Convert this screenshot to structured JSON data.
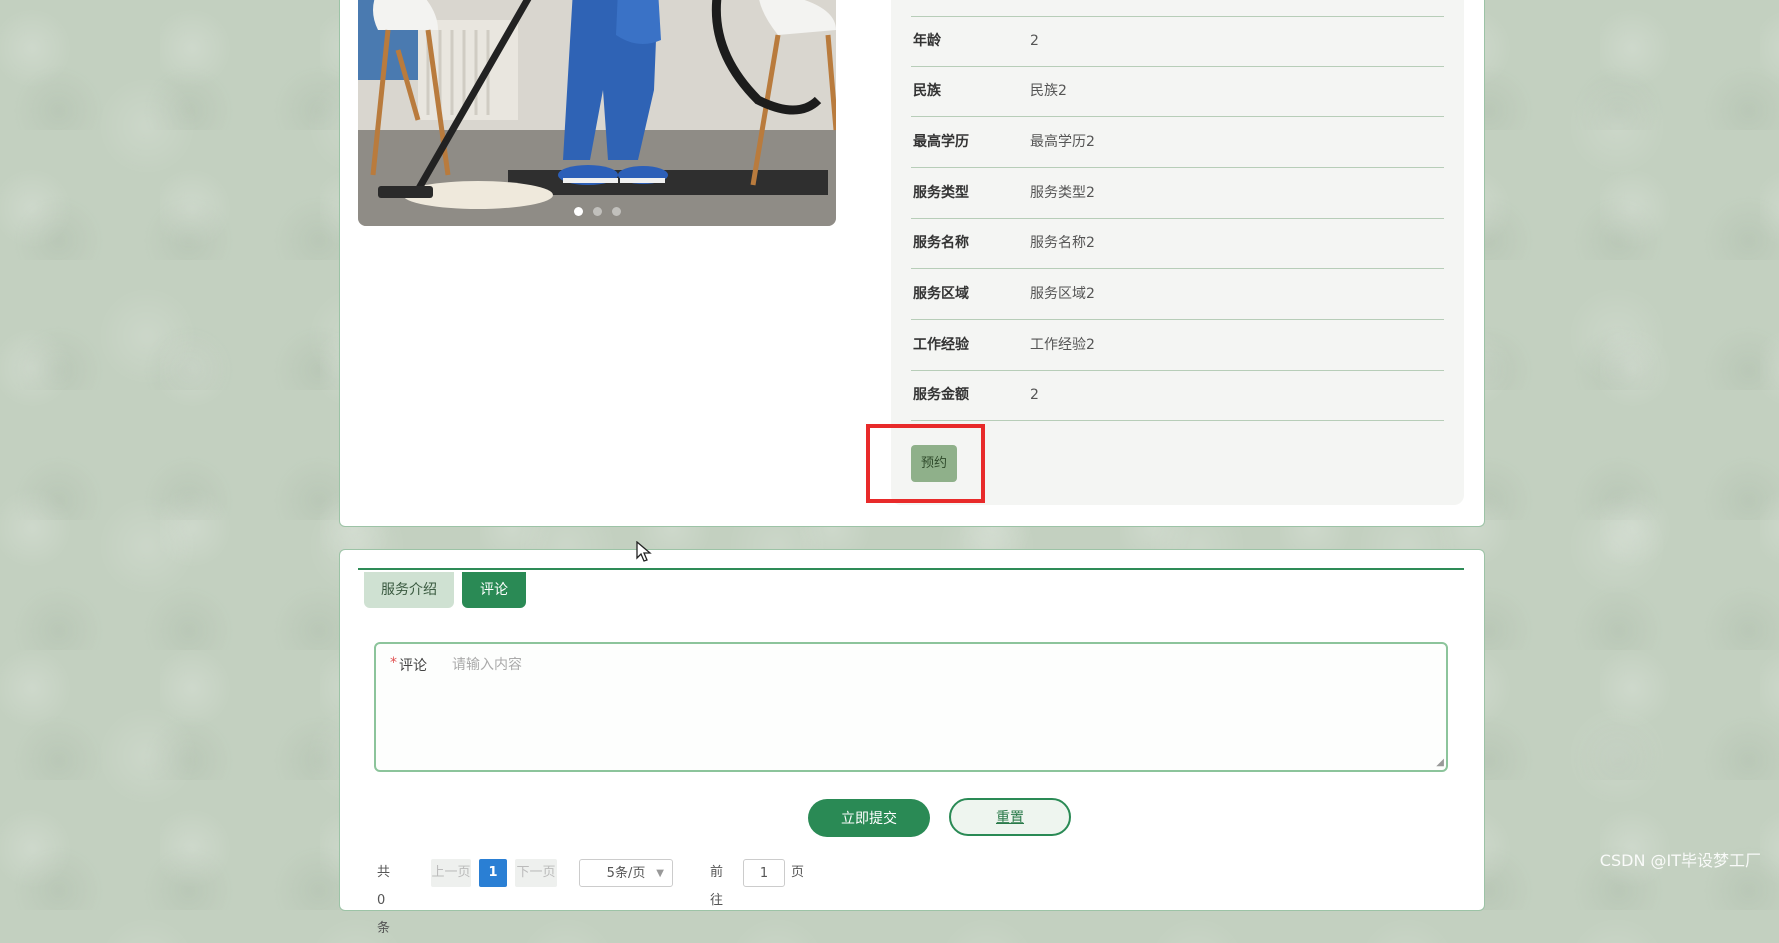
{
  "details": {
    "rows": [
      {
        "label": "年龄",
        "value": "2"
      },
      {
        "label": "民族",
        "value": "民族2"
      },
      {
        "label": "最高学历",
        "value": "最高学历2"
      },
      {
        "label": "服务类型",
        "value": "服务类型2"
      },
      {
        "label": "服务名称",
        "value": "服务名称2"
      },
      {
        "label": "服务区域",
        "value": "服务区域2"
      },
      {
        "label": "工作经验",
        "value": "工作经验2"
      },
      {
        "label": "服务金额",
        "value": "2"
      }
    ],
    "reserve_label": "预约"
  },
  "carousel": {
    "slide_count": 3,
    "active_index": 0
  },
  "tabs": [
    {
      "label": "服务介绍",
      "active": false
    },
    {
      "label": "评论",
      "active": true
    }
  ],
  "comment_form": {
    "label": "评论",
    "required_mark": "*",
    "placeholder": "请输入内容",
    "value": "",
    "submit_label": "立即提交",
    "reset_label": "重置"
  },
  "pagination": {
    "total": "共 0 条",
    "prev": "上一页",
    "current_page": "1",
    "next": "下一页",
    "page_size": "5条/页",
    "goto_prefix": "前往",
    "goto_value": "1",
    "goto_suffix": "页"
  },
  "watermark": "CSDN @IT毕设梦工厂",
  "colors": {
    "primary": "#2a8a55",
    "reserve_button": "#8fb08a",
    "highlight": "#e82a2a",
    "pager_active": "#2a7fd4"
  }
}
